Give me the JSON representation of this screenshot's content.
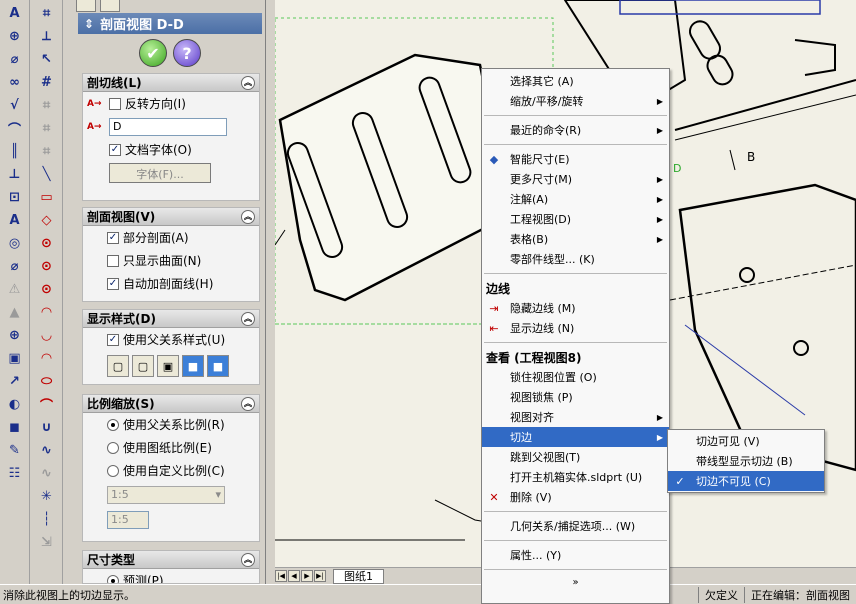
{
  "panel": {
    "title": "剖面视图 D-D",
    "groups": {
      "section_line": {
        "title": "剖切线(L)",
        "flip_direction": "反转方向(I)",
        "label_value": "D",
        "doc_font": "文档字体(O)",
        "font_button": "字体(F)..."
      },
      "section_view": {
        "title": "剖面视图(V)",
        "partial_section": "部分剖面(A)",
        "surfaces_only": "只显示曲面(N)",
        "auto_hatch": "自动加剖面线(H)"
      },
      "display_style": {
        "title": "显示样式(D)",
        "use_parent_style": "使用父关系样式(U)"
      },
      "scale": {
        "title": "比例缩放(S)",
        "use_parent_scale": "使用父关系比例(R)",
        "use_sheet_scale": "使用图纸比例(E)",
        "use_custom_scale": "使用自定义比例(C)",
        "scale_combo": "1:5",
        "scale_text": "1:5"
      },
      "dimension_type": {
        "title": "尺寸类型",
        "projected": "预测(P)"
      }
    }
  },
  "context_menu": {
    "items": [
      {
        "label": "选择其它 (A)",
        "icon": "",
        "submenu": false
      },
      {
        "label": "缩放/平移/旋转",
        "icon": "",
        "submenu": true
      },
      {
        "sep": true
      },
      {
        "label": "最近的命令(R)",
        "icon": "",
        "submenu": true
      },
      {
        "sep": true
      },
      {
        "label": "智能尺寸(E)",
        "icon": "smart-dimension-icon",
        "submenu": false
      },
      {
        "label": "更多尺寸(M)",
        "icon": "",
        "submenu": true
      },
      {
        "label": "注解(A)",
        "icon": "",
        "submenu": true
      },
      {
        "label": "工程视图(D)",
        "icon": "",
        "submenu": true
      },
      {
        "label": "表格(B)",
        "icon": "",
        "submenu": true
      },
      {
        "label": "零部件线型... (K)",
        "icon": "",
        "submenu": false
      },
      {
        "sep": true
      },
      {
        "heading": "边线"
      },
      {
        "label": "隐藏边线 (M)",
        "icon": "hide-edge-icon",
        "submenu": false
      },
      {
        "label": "显示边线 (N)",
        "icon": "show-edge-icon",
        "submenu": false
      },
      {
        "sep": true
      },
      {
        "heading": "查看 (工程视图8)"
      },
      {
        "label": "锁住视图位置 (O)",
        "icon": "",
        "submenu": false
      },
      {
        "label": "视图锁焦 (P)",
        "icon": "",
        "submenu": false
      },
      {
        "label": "视图对齐",
        "icon": "",
        "submenu": true
      },
      {
        "label": "切边",
        "icon": "",
        "submenu": true,
        "highlighted": true
      },
      {
        "label": "跳到父视图(T)",
        "icon": "",
        "submenu": false
      },
      {
        "label": "打开主机箱实体.sldprt (U)",
        "icon": "",
        "submenu": false
      },
      {
        "label": "删除 (V)",
        "icon": "delete-icon",
        "submenu": false
      },
      {
        "sep": true
      },
      {
        "label": "几何关系/捕捉选项... (W)",
        "icon": "",
        "submenu": false
      },
      {
        "sep": true
      },
      {
        "label": "属性... (Y)",
        "icon": "",
        "submenu": false
      },
      {
        "sep": true
      }
    ],
    "more_arrow": "»"
  },
  "sub_menu": {
    "items": [
      {
        "label": "切边可见 (V)",
        "checked": false,
        "highlighted": false
      },
      {
        "label": "带线型显示切边 (B)",
        "checked": false,
        "highlighted": false
      },
      {
        "label": "切边不可见 (C)",
        "checked": true,
        "highlighted": true
      }
    ]
  },
  "drawing": {
    "labels": {
      "b": "B",
      "d": "D"
    },
    "sheet_tab": "图纸1"
  },
  "status": {
    "message": "消除此视图上的切边显示。",
    "undefined": "欠定义",
    "editing": "正在编辑：剖面视图"
  }
}
